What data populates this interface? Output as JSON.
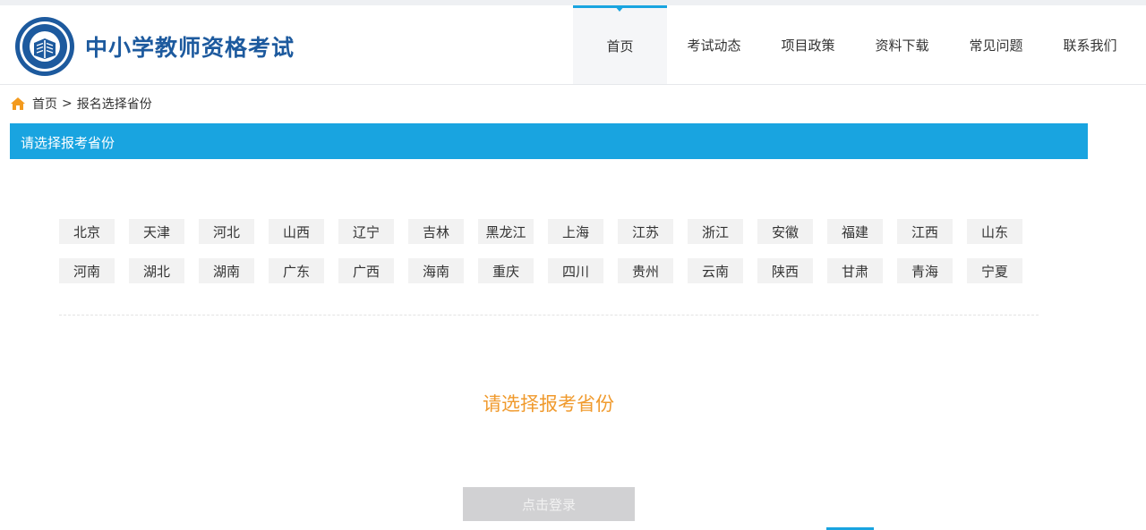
{
  "header": {
    "site_title": "中小学教师资格考试",
    "logo_icon": "exam-book-emblem",
    "nav": [
      {
        "label": "首页",
        "active": true
      },
      {
        "label": "考试动态"
      },
      {
        "label": "项目政策"
      },
      {
        "label": "资料下载"
      },
      {
        "label": "常见问题"
      },
      {
        "label": "联系我们"
      }
    ]
  },
  "breadcrumb": {
    "icon": "home-icon",
    "home": "首页",
    "separator": ">",
    "current": "报名选择省份"
  },
  "section": {
    "title": "请选择报考省份"
  },
  "provinces": [
    "北京",
    "天津",
    "河北",
    "山西",
    "辽宁",
    "吉林",
    "黑龙江",
    "上海",
    "江苏",
    "浙江",
    "安徽",
    "福建",
    "江西",
    "山东",
    "河南",
    "湖北",
    "湖南",
    "广东",
    "广西",
    "海南",
    "重庆",
    "四川",
    "贵州",
    "云南",
    "陕西",
    "甘肃",
    "青海",
    "宁夏"
  ],
  "prompt": "请选择报考省份",
  "login_button": "点击登录",
  "colors": {
    "brand_blue": "#19a4e0",
    "title_blue": "#1d5a9e",
    "prompt_orange": "#f09a2d",
    "home_icon_orange": "#f39a1e",
    "button_disabled": "#d1d1d3"
  }
}
